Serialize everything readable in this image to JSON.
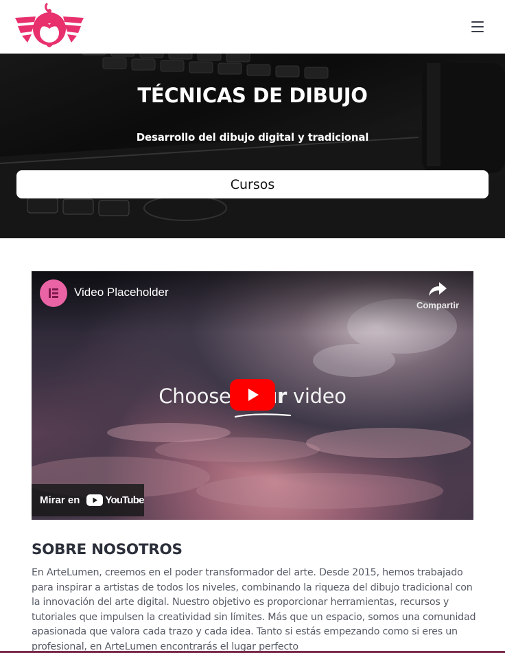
{
  "header": {
    "logo_icon": "artelumen-logo-icon",
    "menu_icon": "hamburger-menu-icon",
    "brand_color": "#e8306d"
  },
  "hero": {
    "title": "TÉCNICAS DE DIBUJO",
    "subtitle": "Desarrollo del dibujo digital y tradicional",
    "button_label": "Cursos"
  },
  "video": {
    "channel_icon": "elementor-icon",
    "title": "Video Placeholder",
    "share_label": "Compartir",
    "overlay_text_start": "Choose ",
    "overlay_text_bold": "your",
    "overlay_text_end": " video",
    "play_icon": "play-icon",
    "watch_on_label": "Mirar en",
    "youtube_label": "YouTube",
    "play_color": "#ff0000"
  },
  "about": {
    "title": "SOBRE NOSOTROS",
    "text": "En ArteLumen, creemos en el poder transformador del arte. Desde 2015, hemos trabajado para inspirar a artistas de todos los niveles, combinando la riqueza del dibujo tradicional con la innovación del arte digital. Nuestro objetivo es proporcionar herramientas, recursos y tutoriales que impulsen la creatividad sin límites. Más que un espacio, somos una comunidad apasionada que valora cada trazo y cada idea. Tanto si estás empezando como si eres un profesional, en ArteLumen encontrarás el lugar perfecto"
  }
}
